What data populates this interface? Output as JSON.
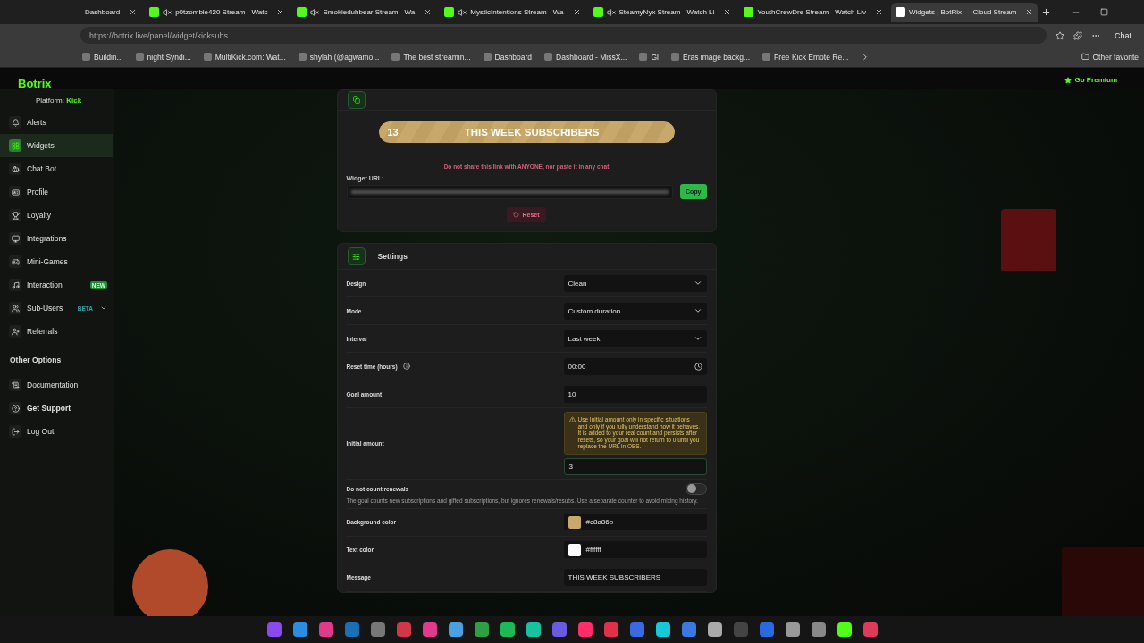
{
  "browser": {
    "tabs": [
      {
        "title": "Dashboard",
        "muted": false,
        "selected": false,
        "kind": "plain"
      },
      {
        "title": "p0tzombie420 Stream - Watc",
        "muted": true,
        "selected": false,
        "kind": "kick"
      },
      {
        "title": "Smokieduhbear Stream - Wa",
        "muted": true,
        "selected": false,
        "kind": "kick"
      },
      {
        "title": "MysticIntentions Stream - Wa",
        "muted": true,
        "selected": false,
        "kind": "kick"
      },
      {
        "title": "SteamyNyx Stream - Watch Li",
        "muted": true,
        "selected": false,
        "kind": "kick"
      },
      {
        "title": "YouthCrewDre Stream - Watch Liv",
        "muted": false,
        "selected": false,
        "kind": "kick"
      },
      {
        "title": "Widgets | BotRix — Cloud Stream",
        "muted": false,
        "selected": true,
        "kind": "botrix"
      }
    ],
    "url": "https://botrix.live/panel/widget/kicksubs",
    "chat_label": "Chat",
    "bookmarks": [
      {
        "label": "Buildin..."
      },
      {
        "label": "night Syndi..."
      },
      {
        "label": "MultiKick.com: Wat..."
      },
      {
        "label": "shylah (@agwamo..."
      },
      {
        "label": "The best streamin..."
      },
      {
        "label": "Dashboard"
      },
      {
        "label": "Dashboard - MissX..."
      },
      {
        "label": "Gl"
      },
      {
        "label": "Eras image backg..."
      },
      {
        "label": "Free Kick Emote Re..."
      }
    ],
    "other_favorites": "Other favorite"
  },
  "topbar": {
    "brand": "Botrix",
    "premium": "Go Premium"
  },
  "sidebar": {
    "platform_label": "Platform:",
    "platform": "Kick",
    "items": [
      {
        "label": "Alerts",
        "selected": false
      },
      {
        "label": "Widgets",
        "selected": true
      },
      {
        "label": "Chat Bot",
        "selected": false
      },
      {
        "label": "Profile",
        "selected": false
      },
      {
        "label": "Loyalty",
        "selected": false
      },
      {
        "label": "Integrations",
        "selected": false
      },
      {
        "label": "Mini-Games",
        "selected": false
      },
      {
        "label": "Interaction",
        "selected": false,
        "badge": "NEW"
      },
      {
        "label": "Sub-Users",
        "selected": false,
        "badge": "BETA",
        "expandable": true
      },
      {
        "label": "Referrals",
        "selected": false
      }
    ],
    "section": "Other Options",
    "other_items": [
      {
        "label": "Documentation",
        "bold": false
      },
      {
        "label": "Get Support",
        "bold": true
      },
      {
        "label": "Log Out",
        "bold": false
      }
    ]
  },
  "widget": {
    "count": "13",
    "message": "THIS WEEK SUBSCRIBERS",
    "level": 1,
    "warning": "Do not share this link with ANYONE, nor paste it in any chat",
    "url_label": "Widget URL:",
    "copy": "Copy",
    "reset": "Reset"
  },
  "settings": {
    "title": "Settings",
    "rows": [
      {
        "kind": "select",
        "label": "Design",
        "value": "Clean"
      },
      {
        "kind": "select",
        "label": "Mode",
        "value": "Custom duration"
      },
      {
        "kind": "select",
        "label": "Interval",
        "value": "Last week"
      },
      {
        "kind": "time",
        "label": "Reset time (hours)",
        "value": "00:00"
      },
      {
        "kind": "input",
        "label": "Goal amount",
        "value": "10"
      },
      {
        "kind": "number",
        "label": "Initial amount",
        "value": "3",
        "note": "Use Initial amount only in specific situations and only if you fully understand how it behaves. It is added to your real count and persists after resets, so your goal will not return to 0 until you replace the URL in OBS."
      },
      {
        "kind": "toggle",
        "label": "Do not count renewals",
        "on": false,
        "description": "The goal counts new subscriptions and gifted subscriptions, but ignores renewals/resubs. Use a separate counter to avoid mixing history."
      },
      {
        "kind": "color",
        "label": "Background color",
        "value": "#c8a86b",
        "color": "#c8a86b"
      },
      {
        "kind": "color",
        "label": "Text color",
        "value": "#ffffff",
        "color": "#ffffff"
      },
      {
        "kind": "input",
        "label": "Message",
        "value": "THIS WEEK SUBSCRIBERS"
      }
    ]
  }
}
